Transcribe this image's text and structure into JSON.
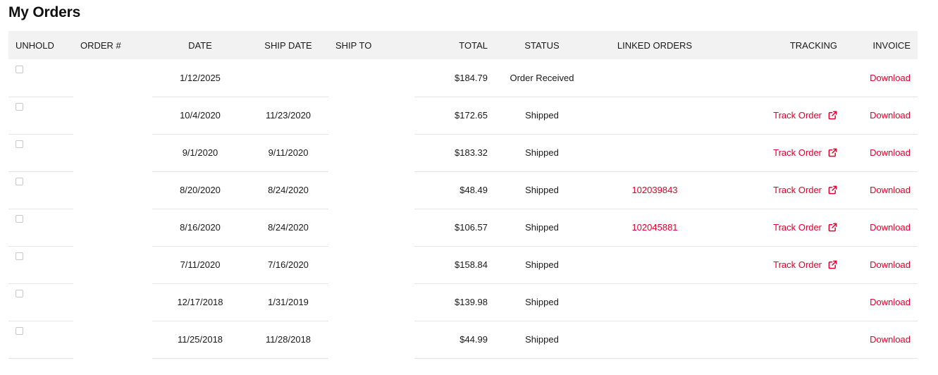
{
  "page": {
    "title": "My Orders"
  },
  "colors": {
    "accent": "#e4002b",
    "header_bg": "#f2f2f2",
    "row_border": "#e6e6e6"
  },
  "table": {
    "headers": {
      "unhold": "UNHOLD",
      "order": "ORDER #",
      "date": "DATE",
      "ship_date": "SHIP DATE",
      "ship_to": "SHIP TO",
      "total": "TOTAL",
      "status": "STATUS",
      "linked_orders": "LINKED ORDERS",
      "tracking": "TRACKING",
      "invoice": "INVOICE"
    },
    "rows": [
      {
        "date": "1/12/2025",
        "ship_date": "",
        "total": "$184.79",
        "status": "Order Received",
        "linked": "",
        "tracking": "",
        "invoice": "Download"
      },
      {
        "date": "10/4/2020",
        "ship_date": "11/23/2020",
        "total": "$172.65",
        "status": "Shipped",
        "linked": "",
        "tracking": "Track Order",
        "invoice": "Download"
      },
      {
        "date": "9/1/2020",
        "ship_date": "9/11/2020",
        "total": "$183.32",
        "status": "Shipped",
        "linked": "",
        "tracking": "Track Order",
        "invoice": "Download"
      },
      {
        "date": "8/20/2020",
        "ship_date": "8/24/2020",
        "total": "$48.49",
        "status": "Shipped",
        "linked": "102039843",
        "tracking": "Track Order",
        "invoice": "Download"
      },
      {
        "date": "8/16/2020",
        "ship_date": "8/24/2020",
        "total": "$106.57",
        "status": "Shipped",
        "linked": "102045881",
        "tracking": "Track Order",
        "invoice": "Download"
      },
      {
        "date": "7/11/2020",
        "ship_date": "7/16/2020",
        "total": "$158.84",
        "status": "Shipped",
        "linked": "",
        "tracking": "Track Order",
        "invoice": "Download"
      },
      {
        "date": "12/17/2018",
        "ship_date": "1/31/2019",
        "total": "$139.98",
        "status": "Shipped",
        "linked": "",
        "tracking": "",
        "invoice": "Download"
      },
      {
        "date": "11/25/2018",
        "ship_date": "11/28/2018",
        "total": "$44.99",
        "status": "Shipped",
        "linked": "",
        "tracking": "",
        "invoice": "Download"
      }
    ]
  },
  "icons": {
    "tracking_link": "external-link-icon",
    "unhold": "checkbox"
  }
}
